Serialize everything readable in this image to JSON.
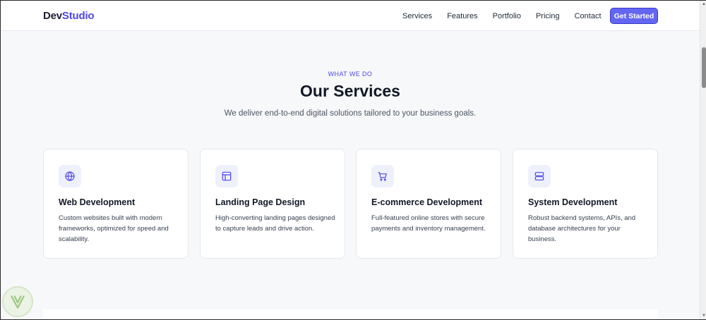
{
  "header": {
    "logo_part1": "Dev",
    "logo_part2": "Studio",
    "nav": [
      "Services",
      "Features",
      "Portfolio",
      "Pricing",
      "Contact"
    ],
    "cta": "Get Started"
  },
  "section": {
    "eyebrow": "WHAT WE DO",
    "title": "Our Services",
    "subtitle": "We deliver end-to-end digital solutions tailored to your business goals."
  },
  "cards": [
    {
      "icon": "globe-icon",
      "title": "Web Development",
      "text": "Custom websites built with modern frameworks, optimized for speed and scalability."
    },
    {
      "icon": "layout-icon",
      "title": "Landing Page Design",
      "text": "High-converting landing pages designed to capture leads and drive action."
    },
    {
      "icon": "cart-icon",
      "title": "E-commerce Development",
      "text": "Full-featured online stores with secure payments and inventory management."
    },
    {
      "icon": "server-icon",
      "title": "System Development",
      "text": "Robust backend systems, APIs, and database architectures for your business."
    }
  ],
  "colors": {
    "accent": "#6366f1",
    "brand": "#4f46e5",
    "background": "#f7f8fa"
  }
}
